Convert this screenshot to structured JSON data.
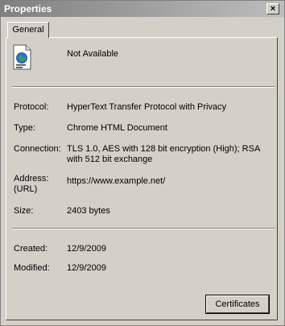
{
  "window": {
    "title": "Properties",
    "close_glyph": "×"
  },
  "tabs": [
    {
      "label": "General"
    }
  ],
  "header": {
    "icon": "html-document-icon",
    "name": "Not Available"
  },
  "rows": [
    {
      "label": "Protocol:",
      "value": "HyperText Transfer Protocol with Privacy"
    },
    {
      "label": "Type:",
      "value": "Chrome HTML Document"
    },
    {
      "label": "Connection:",
      "value": "TLS 1.0, AES with 128 bit encryption (High); RSA with 512 bit exchange"
    },
    {
      "label": "Address:",
      "label2": "(URL)",
      "value": "https://www.example.net/"
    },
    {
      "label": "Size:",
      "value": "2403 bytes"
    },
    {
      "label": "Created:",
      "value": "12/9/2009"
    },
    {
      "label": "Modified:",
      "value": "12/9/2009"
    }
  ],
  "buttons": {
    "certificates": "Certificates"
  }
}
